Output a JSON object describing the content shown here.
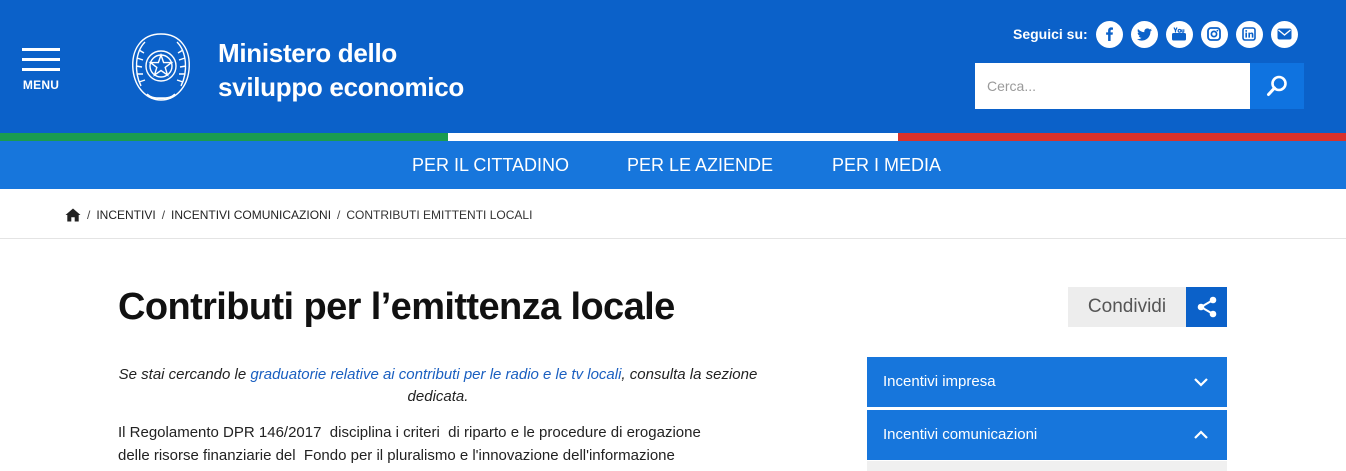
{
  "header": {
    "menu_label": "MENU",
    "ministry_line1": "Ministero dello",
    "ministry_line2": "sviluppo economico",
    "follow_label": "Seguici su:",
    "social_icons": [
      "facebook-icon",
      "twitter-icon",
      "youtube-icon",
      "instagram-icon",
      "linkedin-icon",
      "email-icon"
    ],
    "search_placeholder": "Cerca...",
    "colors": {
      "header_bg": "#0b61c9",
      "nav_bg": "#1776dc",
      "flag_green": "#1a9b4f",
      "flag_white": "#ffffff",
      "flag_red": "#d8322c"
    }
  },
  "nav": {
    "items": [
      "PER IL CITTADINO",
      "PER LE AZIENDE",
      "PER I MEDIA"
    ]
  },
  "breadcrumb": {
    "home_icon": "home-icon",
    "items": [
      "INCENTIVI",
      "INCENTIVI COMUNICAZIONI",
      "CONTRIBUTI EMITTENTI LOCALI"
    ],
    "separator": "/"
  },
  "main": {
    "title": "Contributi per l’emittenza locale",
    "notice_before": "Se stai cercando le ",
    "notice_link": "graduatorie relative ai contributi per le radio e le tv locali",
    "notice_after": ", consulta la sezione dedicata.",
    "body_line1": "Il Regolamento DPR 146/2017  disciplina i criteri  di riparto e le procedure di erogazione",
    "body_line2": "delle risorse finanziarie del  Fondo per il pluralismo e l'innovazione dell'informazione"
  },
  "share": {
    "label": "Condividi",
    "icon": "share-icon"
  },
  "sidebar": {
    "items": [
      {
        "label": "Incentivi impresa",
        "state": "collapsed"
      },
      {
        "label": "Incentivi comunicazioni",
        "state": "expanded"
      }
    ]
  }
}
